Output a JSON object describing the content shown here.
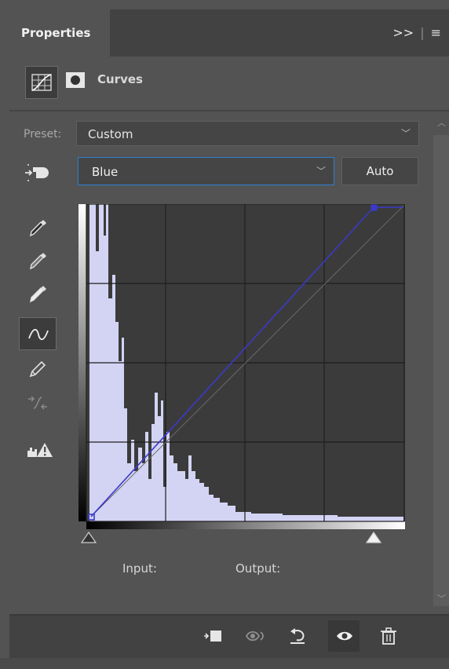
{
  "panel": {
    "tab_title": "Properties",
    "tab_expand_icon": ">>",
    "menu_icon": "hamburger-menu-icon"
  },
  "adjustment": {
    "type_label": "Curves",
    "adjustment_icon": "curves-grid-icon",
    "mask_icon": "layer-mask-icon"
  },
  "preset": {
    "label": "Preset:",
    "value": "Custom"
  },
  "channel": {
    "value": "Blue",
    "auto_label": "Auto"
  },
  "tools": [
    {
      "name": "sample-black-point-icon"
    },
    {
      "name": "sample-gray-point-icon"
    },
    {
      "name": "sample-white-point-icon"
    },
    {
      "name": "edit-points-curve-icon",
      "active": true
    },
    {
      "name": "draw-pencil-icon"
    },
    {
      "name": "smooth-curve-icon",
      "disabled": true
    },
    {
      "name": "clipping-warning-icon"
    }
  ],
  "curve": {
    "channel_color": "#3a3ac8",
    "points": [
      [
        0,
        0
      ],
      [
        255,
        255
      ]
    ]
  },
  "readout": {
    "input_label": "Input:",
    "output_label": "Output:"
  },
  "footer": {
    "buttons": [
      "clip-to-layer-icon",
      "view-previous-state-icon",
      "reset-icon",
      "visibility-eye-icon",
      "delete-trash-icon"
    ]
  }
}
